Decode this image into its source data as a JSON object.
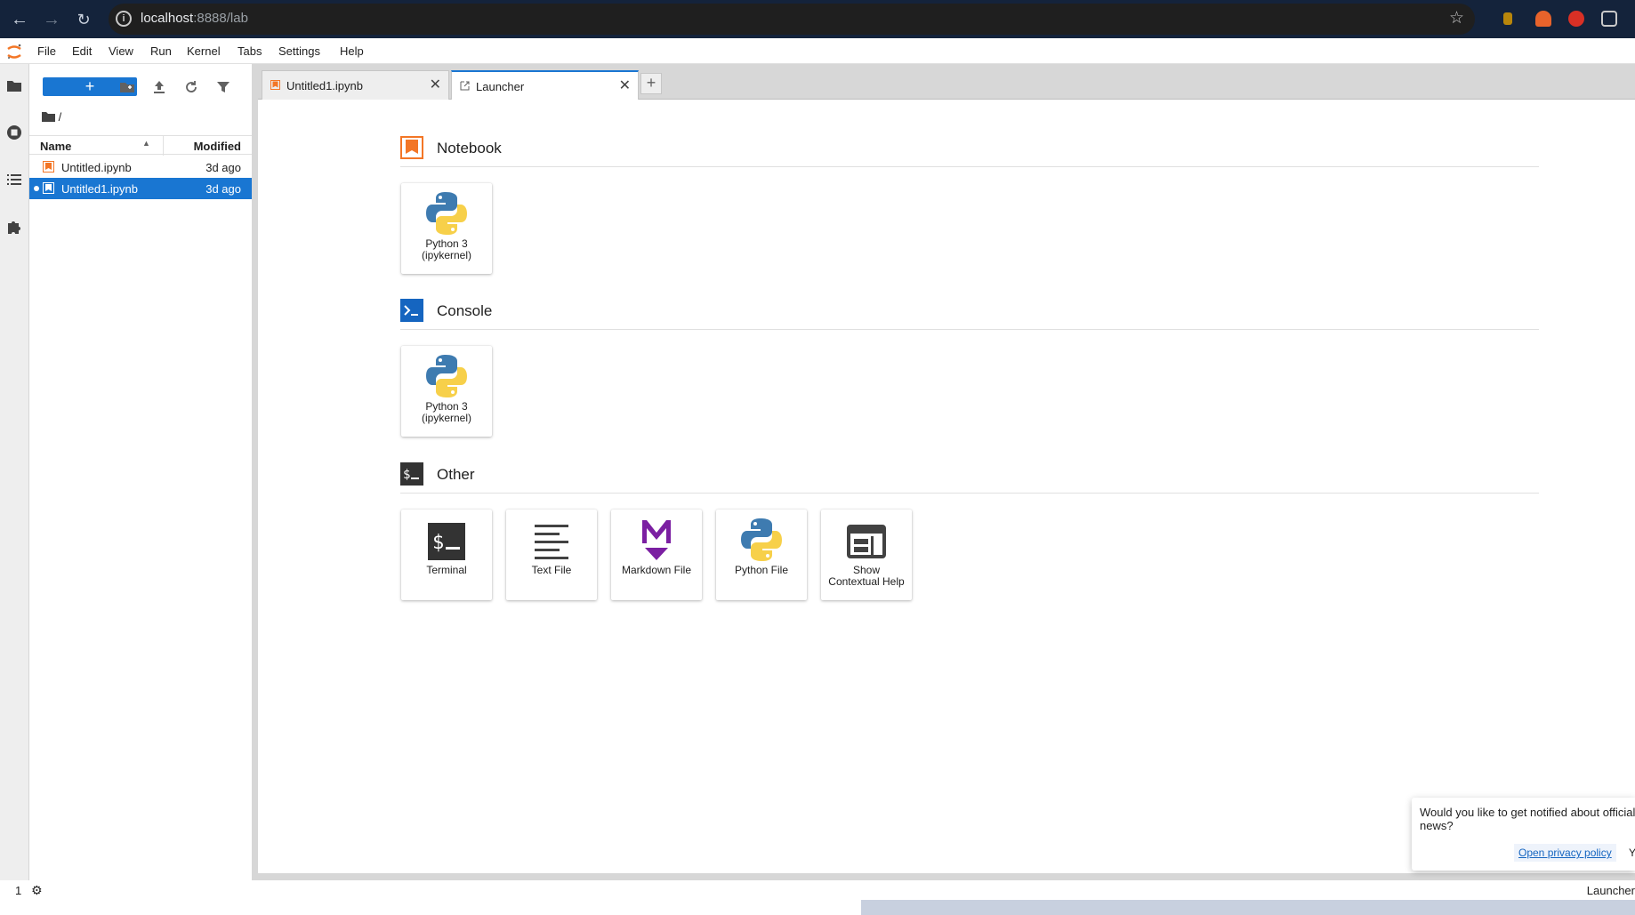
{
  "browser": {
    "url_host": "localhost",
    "url_rest": ":8888/lab"
  },
  "menu": [
    "File",
    "Edit",
    "View",
    "Run",
    "Kernel",
    "Tabs",
    "Settings",
    "Help"
  ],
  "filebrowser": {
    "new_label": "+",
    "breadcrumb": "/",
    "col_name": "Name",
    "col_modified": "Modified",
    "files": [
      {
        "name": "Untitled.ipynb",
        "modified": "3d ago"
      },
      {
        "name": "Untitled1.ipynb",
        "modified": "3d ago"
      }
    ]
  },
  "tabs": [
    {
      "label": "Untitled1.ipynb",
      "close": "✕"
    },
    {
      "label": "Launcher",
      "close": "✕"
    }
  ],
  "add_tab": "+",
  "launcher": {
    "notebook": {
      "title": "Notebook",
      "cards": [
        {
          "line1": "Python 3",
          "line2": "(ipykernel)"
        }
      ]
    },
    "console": {
      "title": "Console",
      "cards": [
        {
          "line1": "Python 3",
          "line2": "(ipykernel)"
        }
      ]
    },
    "other": {
      "title": "Other",
      "cards": [
        {
          "line1": "Terminal",
          "line2": ""
        },
        {
          "line1": "Text File",
          "line2": ""
        },
        {
          "line1": "Markdown File",
          "line2": ""
        },
        {
          "line1": "Python File",
          "line2": ""
        },
        {
          "line1": "Show",
          "line2": "Contextual Help"
        }
      ]
    }
  },
  "notification": {
    "message": "Would you like to get notified about official Jupyter news?",
    "link": "Open privacy policy",
    "yes": "Y"
  },
  "status": {
    "count": "1",
    "right": "Launcher"
  },
  "colors": {
    "accent": "#1976d2",
    "jupyter_orange": "#f37626",
    "markdown_purple": "#7b1fa2"
  }
}
